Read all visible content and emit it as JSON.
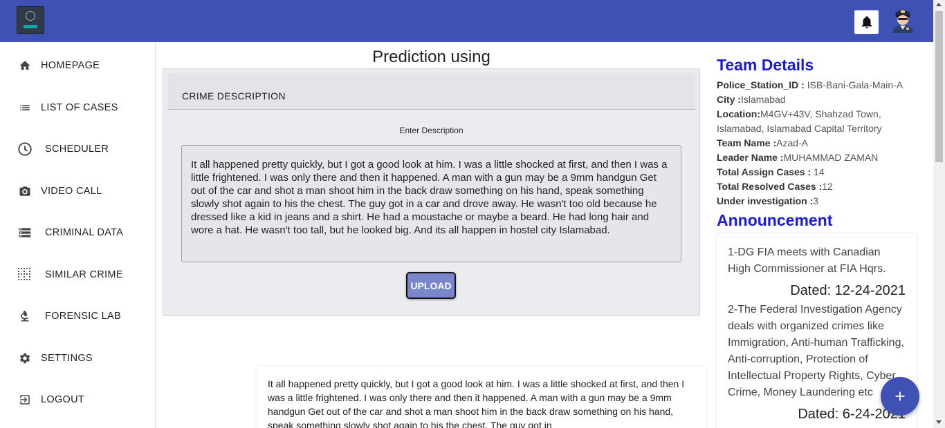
{
  "nav": {
    "items": [
      {
        "label": "HOMEPAGE",
        "icon": "home-icon"
      },
      {
        "label": "LIST OF CASES",
        "icon": "list-icon"
      },
      {
        "label": "SCHEDULER",
        "icon": "clock-icon"
      },
      {
        "label": "VIDEO CALL",
        "icon": "camera-icon"
      },
      {
        "label": "CRIMINAL DATA",
        "icon": "storage-icon"
      },
      {
        "label": "SIMILAR CRIME",
        "icon": "grid-dots-icon"
      },
      {
        "label": "FORENSIC LAB",
        "icon": "microscope-icon"
      },
      {
        "label": "SETTINGS",
        "icon": "gear-icon"
      },
      {
        "label": "LOGOUT",
        "icon": "logout-icon"
      }
    ]
  },
  "main": {
    "title": "Prediction using",
    "card_header": "CRIME DESCRIPTION",
    "field_label": "Enter Description",
    "description": "It all happened pretty quickly, but I got a good look at him. I was a little shocked at first, and then I was a little frightened. I was only there and then it happened. A man with a gun may be a 9mm handgun Get out of the car and shot a man shoot him in the back draw something on his hand, speak something slowly shot again to his the chest. The guy got in a car and drove away. He wasn't too old because he dressed like a kid in jeans and a shirt. He had a moustache or maybe a beard. He had long hair and wore a hat. He wasn't too tall, but he looked big. And its all happen in hostel city Islamabad.",
    "upload_label": "UPLOAD",
    "result_text": "It all happened pretty quickly, but I got a good look at him. I was a little shocked at first, and then I was a little frightened. I was only there and then it happened. A man with a gun may be a 9mm handgun Get out of the car and shot a man shoot him in the back draw something on his hand, speak something slowly shot again to his the chest. The guy got in"
  },
  "team": {
    "title": "Team Details",
    "rows": [
      {
        "label": "Police_Station_ID : ",
        "value": "ISB-Bani-Gala-Main-A"
      },
      {
        "label": "City :",
        "value": "Islamabad"
      },
      {
        "label": "Location:",
        "value": "M4GV+43V, Shahzad Town, Islamabad, Islamabad Capital Territory"
      },
      {
        "label": "Team Name :",
        "value": "Azad-A"
      },
      {
        "label": "Leader Name :",
        "value": "MUHAMMAD ZAMAN"
      },
      {
        "label": "Total Assign Cases : ",
        "value": "14"
      },
      {
        "label": "Total Resolved Cases :",
        "value": "12"
      },
      {
        "label": "Under investigation :",
        "value": "3"
      }
    ]
  },
  "announcement": {
    "title": "Announcement",
    "item1": "1-DG FIA meets with Canadian High Commissioner at FIA Hqrs.",
    "date1": "Dated: 12-24-2021",
    "item2": "2-The Federal Investigation Agency deals with organized crimes like Immigration, Anti-human Trafficking, Anti-corruption, Protection of Intellectual Property Rights, Cyber Crime, Money Laundering etc",
    "date2": "Dated: 6-24-2021"
  },
  "fab_label": "+",
  "colors": {
    "primary": "#3f51b5",
    "heading": "#1a1ad9",
    "upload": "#7986cb"
  }
}
